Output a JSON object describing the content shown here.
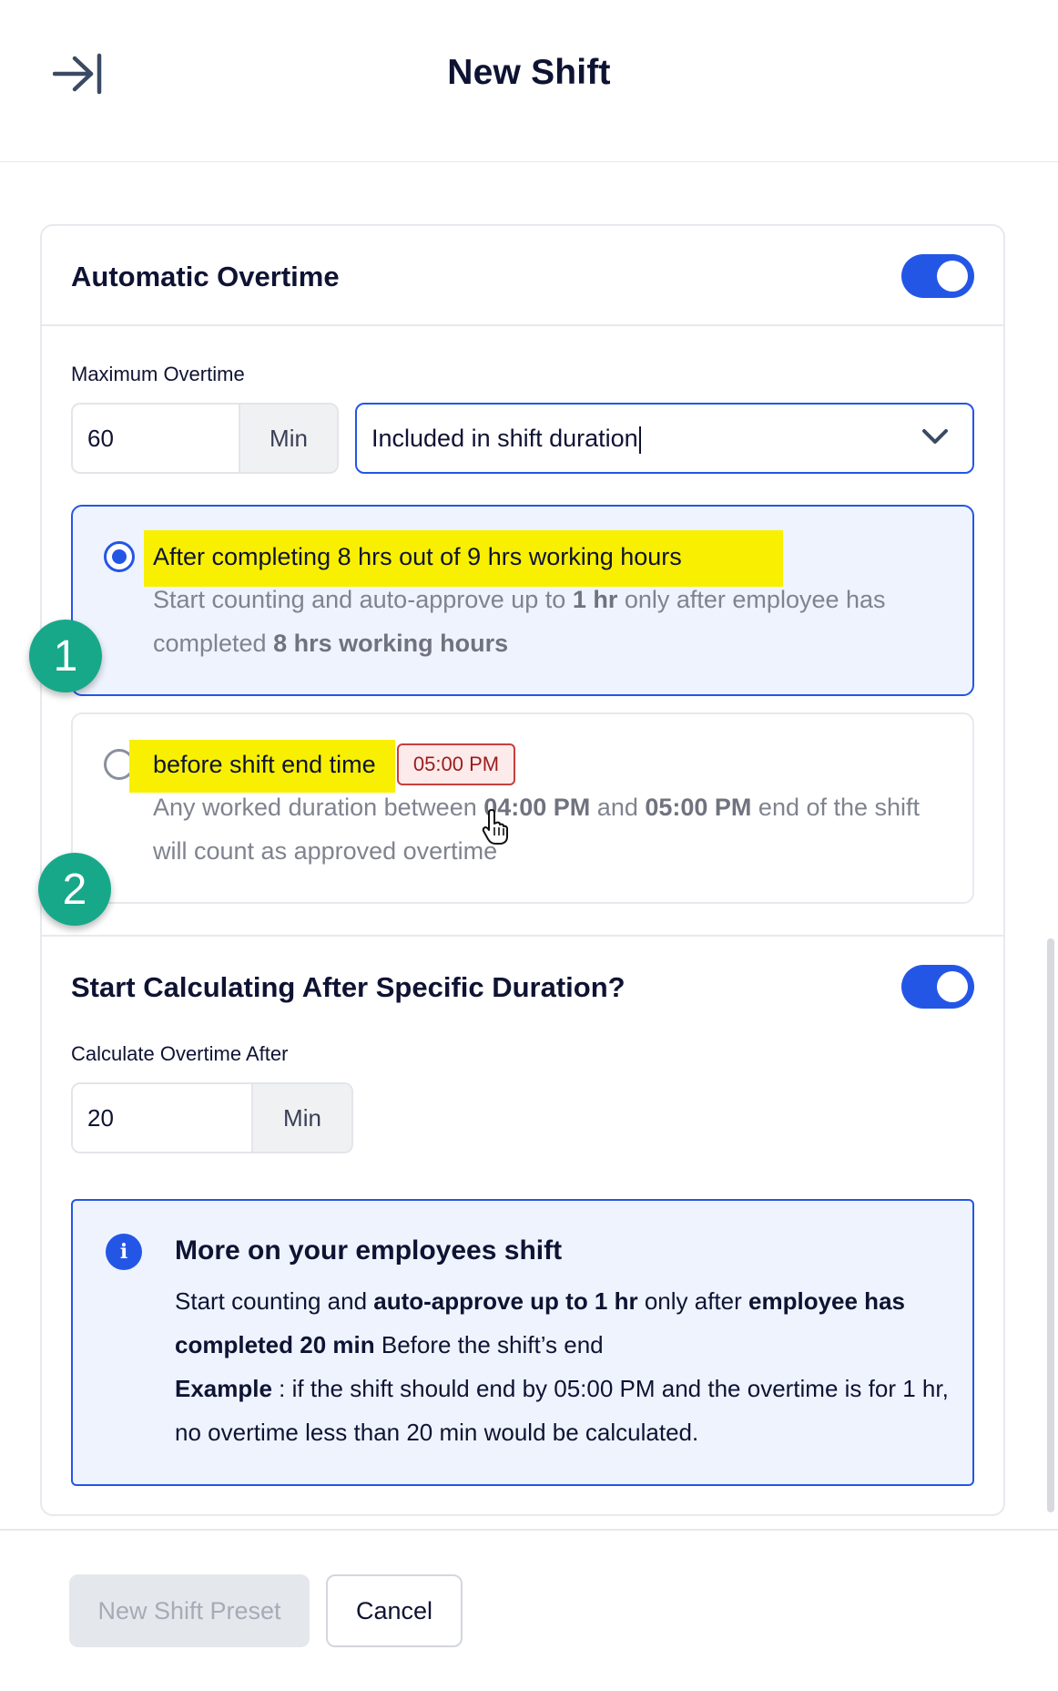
{
  "header": {
    "title": "New Shift",
    "collapse_icon": "collapse-panel-icon"
  },
  "overtime": {
    "section_title": "Automatic Overtime",
    "enabled": true,
    "max_label": "Maximum Overtime",
    "max_value": "60",
    "max_unit": "Min",
    "mode_value": "Included in shift duration",
    "options": [
      {
        "selected": true,
        "title": "After completing 8 hrs out of 9 hrs working hours",
        "desc_1": "Start counting and auto-approve up to ",
        "desc_bold_1": "1 hr",
        "desc_2": " only after employee has completed ",
        "desc_bold_2": "8 hrs working hours",
        "marker": "1"
      },
      {
        "selected": false,
        "title": "before shift end time",
        "badge": "05:00 PM",
        "desc_1": "Any worked duration between ",
        "desc_bold_1": "04:00 PM",
        "desc_2": " and ",
        "desc_bold_2": "05:00 PM",
        "desc_3": " end of the shift will count as approved overtime",
        "marker": "2"
      }
    ]
  },
  "calc": {
    "section_title": "Start Calculating After Specific Duration?",
    "enabled": true,
    "label": "Calculate Overtime After",
    "value": "20",
    "unit": "Min"
  },
  "info": {
    "icon": "info-icon",
    "icon_glyph": "i",
    "title": "More on your employees shift",
    "p1_a": "Start counting and ",
    "p1_b": "auto-approve up to 1 hr",
    "p1_c": " only after ",
    "p1_d": "employee has completed 20 min",
    "p1_e": " Before the shift’s end",
    "p2_a": "Example",
    "p2_b": " : if the shift should end by 05:00 PM and the overtime is for 1 hr, no overtime less than 20 min would be calculated."
  },
  "footer": {
    "primary_label": "New Shift Preset",
    "cancel_label": "Cancel"
  },
  "colors": {
    "accent": "#2456e6",
    "highlight": "#f8f000",
    "marker": "#17a88a",
    "badge_border": "#c53f3f"
  }
}
